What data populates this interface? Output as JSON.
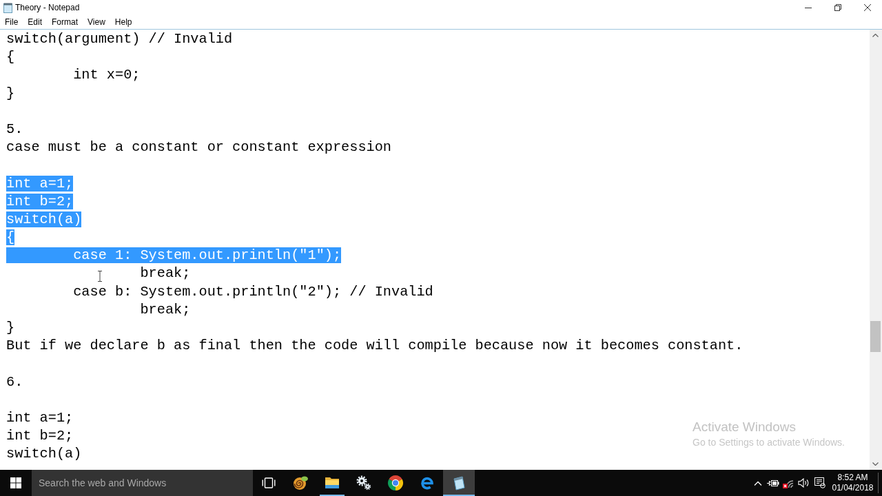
{
  "window": {
    "title": "Theory - Notepad"
  },
  "menu": [
    "File",
    "Edit",
    "Format",
    "View",
    "Help"
  ],
  "editor": {
    "blocks": [
      {
        "lines": [
          {
            "text": "switch(argument) // Invalid",
            "selected": false
          },
          {
            "text": "{",
            "selected": false
          },
          {
            "text": "\tint x=0;",
            "selected": false
          },
          {
            "text": "}",
            "selected": false
          }
        ]
      },
      {
        "lines": [
          {
            "text": "5.",
            "selected": false
          },
          {
            "text": "case must be a constant or constant expression",
            "selected": false
          }
        ]
      },
      {
        "lines": [
          {
            "text": "int a=1;",
            "selected": true
          },
          {
            "text": "int b=2;",
            "selected": true
          },
          {
            "text": "switch(a)",
            "selected": true
          },
          {
            "text": "{",
            "selected": true
          },
          {
            "text": "\tcase 1: System.out.println(\"1\");",
            "selected": true
          },
          {
            "text": "\t\tbreak;",
            "selected": false
          },
          {
            "text": "\tcase b: System.out.println(\"2\"); // Invalid",
            "selected": false
          },
          {
            "text": "\t\tbreak;",
            "selected": false
          },
          {
            "text": "}",
            "selected": false
          },
          {
            "text": "But if we declare b as final then the code will compile because now it becomes constant.",
            "selected": false
          }
        ]
      },
      {
        "lines": [
          {
            "text": "6.",
            "selected": false
          }
        ]
      },
      {
        "lines": [
          {
            "text": "int a=1;",
            "selected": false
          },
          {
            "text": "int b=2;",
            "selected": false
          },
          {
            "text": "switch(a)",
            "selected": false
          }
        ]
      }
    ]
  },
  "activation_notice": {
    "title": "Activate Windows",
    "message": "Go to Settings to activate Windows."
  },
  "taskbar": {
    "search": {
      "placeholder": "Search the web and Windows"
    },
    "apps": [
      {
        "kind": "swirl",
        "running": false,
        "active": false
      },
      {
        "kind": "folder",
        "running": true,
        "active": false
      },
      {
        "kind": "gears",
        "running": false,
        "active": false
      },
      {
        "kind": "orb",
        "running": false,
        "active": false
      },
      {
        "kind": "e",
        "running": false,
        "active": false
      },
      {
        "kind": "notepad",
        "running": true,
        "active": true
      }
    ],
    "clock": {
      "time": "8:52 AM",
      "date": "01/04/2018"
    }
  }
}
